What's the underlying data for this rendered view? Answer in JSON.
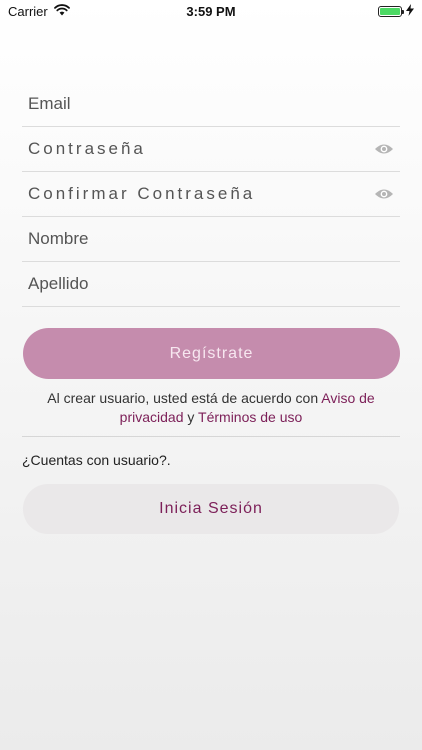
{
  "status_bar": {
    "carrier": "Carrier",
    "time": "3:59 PM",
    "battery_level": 1.0
  },
  "form": {
    "email_placeholder": "Email",
    "password_placeholder": "Contraseña",
    "confirm_password_placeholder": "Confirmar Contraseña",
    "first_name_placeholder": "Nombre",
    "last_name_placeholder": "Apellido"
  },
  "register_button": {
    "label": "Regístrate"
  },
  "terms": {
    "prefix": "Al crear usuario, usted está de acuerdo con ",
    "privacy_link": "Aviso de privacidad",
    "conjunction": " y ",
    "terms_link": "Términos de uso"
  },
  "login": {
    "question": "¿Cuentas con usuario?.",
    "button_label": "Inicia Sesión"
  },
  "colors": {
    "accent": "#7c1f58",
    "button_pink": "#c58cad",
    "battery": "#4cd964"
  },
  "icons": [
    "wifi-icon",
    "battery-icon",
    "charging-icon",
    "eye-icon"
  ]
}
